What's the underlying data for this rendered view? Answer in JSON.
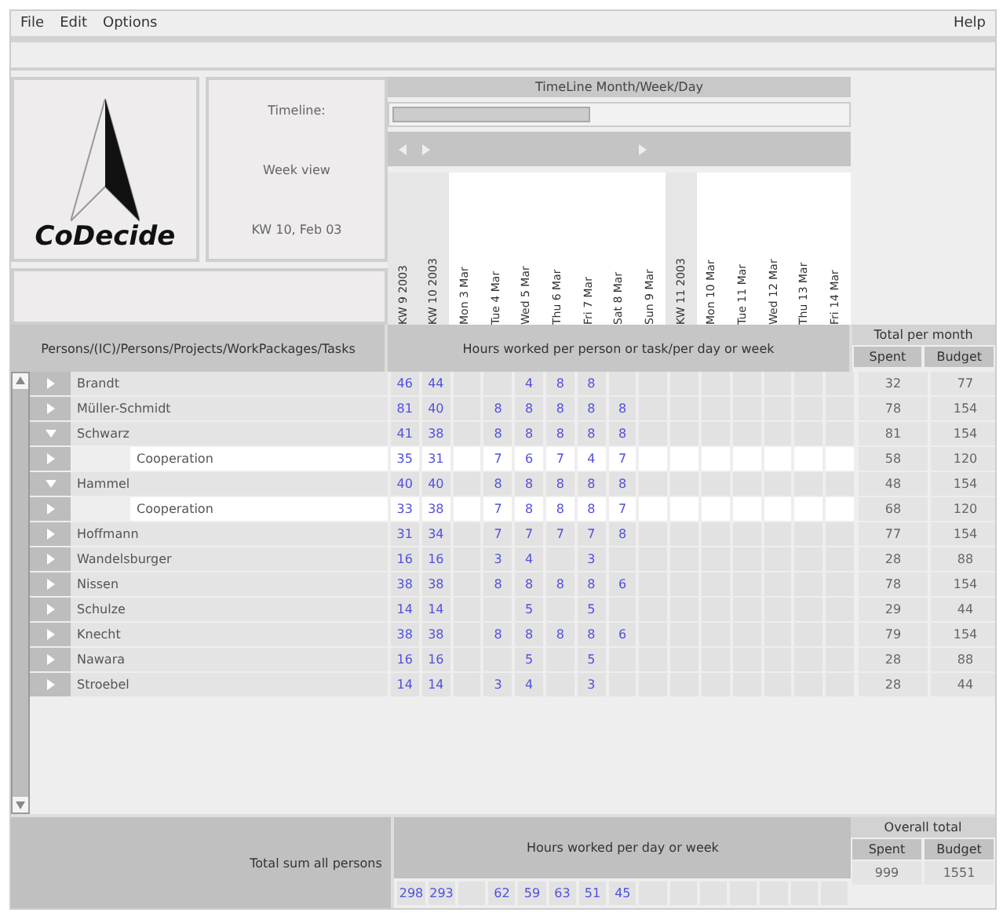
{
  "menu": {
    "items": [
      "File",
      "Edit",
      "Options"
    ],
    "help": "Help"
  },
  "logo": {
    "text": "CoDecide"
  },
  "info": [
    "Timeline:",
    "Week view",
    "KW 10, Feb 03"
  ],
  "timeline": {
    "title": "TimeLine Month/Week/Day"
  },
  "columns": [
    {
      "label": "KW 9 2003",
      "kind": "week"
    },
    {
      "label": "KW 10 2003",
      "kind": "week"
    },
    {
      "label": "Mon 3 Mar",
      "kind": "day"
    },
    {
      "label": "Tue 4 Mar",
      "kind": "day"
    },
    {
      "label": "Wed 5 Mar",
      "kind": "day"
    },
    {
      "label": "Thu 6 Mar",
      "kind": "day"
    },
    {
      "label": "Fri 7 Mar",
      "kind": "day"
    },
    {
      "label": "Sat 8 Mar",
      "kind": "day"
    },
    {
      "label": "Sun 9 Mar",
      "kind": "day"
    },
    {
      "label": "KW 11 2003",
      "kind": "week"
    },
    {
      "label": "Mon 10 Mar",
      "kind": "day"
    },
    {
      "label": "Tue 11 Mar",
      "kind": "day"
    },
    {
      "label": "Wed 12 Mar",
      "kind": "day"
    },
    {
      "label": "Thu 13 Mar",
      "kind": "day"
    },
    {
      "label": "Fri 14 Mar",
      "kind": "day"
    }
  ],
  "tree_header": "Persons/(IC)/Persons/Projects/WorkPackages/Tasks",
  "grid_header": "Hours worked per person or task/per day or week",
  "totals_header": "Total per month",
  "spent_header": "Spent",
  "budget_header": "Budget",
  "persons": [
    {
      "name": "Brandt",
      "expanded": false,
      "hours": {
        "0": "46",
        "1": "44",
        "4": "4",
        "5": "8",
        "6": "8"
      },
      "spent": "32",
      "budget": "77"
    },
    {
      "name": "Müller-Schmidt",
      "expanded": false,
      "hours": {
        "0": "81",
        "1": "40",
        "3": "8",
        "4": "8",
        "5": "8",
        "6": "8",
        "7": "8"
      },
      "spent": "78",
      "budget": "154"
    },
    {
      "name": "Schwarz",
      "expanded": true,
      "hours": {
        "0": "41",
        "1": "38",
        "3": "8",
        "4": "8",
        "5": "8",
        "6": "8",
        "7": "8"
      },
      "spent": "81",
      "budget": "154",
      "children": [
        {
          "name": "Cooperation",
          "hours": {
            "0": "35",
            "1": "31",
            "3": "7",
            "4": "6",
            "5": "7",
            "6": "4",
            "7": "7"
          },
          "spent": "58",
          "budget": "120"
        }
      ]
    },
    {
      "name": "Hammel",
      "expanded": true,
      "hours": {
        "0": "40",
        "1": "40",
        "3": "8",
        "4": "8",
        "5": "8",
        "6": "8",
        "7": "8"
      },
      "spent": "48",
      "budget": "154",
      "children": [
        {
          "name": "Cooperation",
          "hours": {
            "0": "33",
            "1": "38",
            "3": "7",
            "4": "8",
            "5": "8",
            "6": "8",
            "7": "7"
          },
          "spent": "68",
          "budget": "120"
        }
      ]
    },
    {
      "name": "Hoffmann",
      "expanded": false,
      "hours": {
        "0": "31",
        "1": "34",
        "3": "7",
        "4": "7",
        "5": "7",
        "6": "7",
        "7": "8"
      },
      "spent": "77",
      "budget": "154"
    },
    {
      "name": "Wandelsburger",
      "expanded": false,
      "hours": {
        "0": "16",
        "1": "16",
        "3": "3",
        "4": "4",
        "6": "3"
      },
      "spent": "28",
      "budget": "88"
    },
    {
      "name": "Nissen",
      "expanded": false,
      "hours": {
        "0": "38",
        "1": "38",
        "3": "8",
        "4": "8",
        "5": "8",
        "6": "8",
        "7": "6"
      },
      "spent": "78",
      "budget": "154"
    },
    {
      "name": "Schulze",
      "expanded": false,
      "hours": {
        "0": "14",
        "1": "14",
        "4": "5",
        "6": "5"
      },
      "spent": "29",
      "budget": "44"
    },
    {
      "name": "Knecht",
      "expanded": false,
      "hours": {
        "0": "38",
        "1": "38",
        "3": "8",
        "4": "8",
        "5": "8",
        "6": "8",
        "7": "6"
      },
      "spent": "79",
      "budget": "154"
    },
    {
      "name": "Nawara",
      "expanded": false,
      "hours": {
        "0": "16",
        "1": "16",
        "4": "5",
        "6": "5"
      },
      "spent": "28",
      "budget": "88"
    },
    {
      "name": "Stroebel",
      "expanded": false,
      "hours": {
        "0": "14",
        "1": "14",
        "3": "3",
        "4": "4",
        "6": "3"
      },
      "spent": "28",
      "budget": "44"
    }
  ],
  "footer": {
    "label": "Total sum all persons",
    "grid_header": "Hours worked per day or week",
    "overall": "Overall total",
    "spent_header": "Spent",
    "budget_header": "Budget",
    "hours": {
      "0": "298",
      "1": "293",
      "3": "62",
      "4": "59",
      "5": "63",
      "6": "51",
      "7": "45"
    },
    "spent": "999",
    "budget": "1551"
  }
}
